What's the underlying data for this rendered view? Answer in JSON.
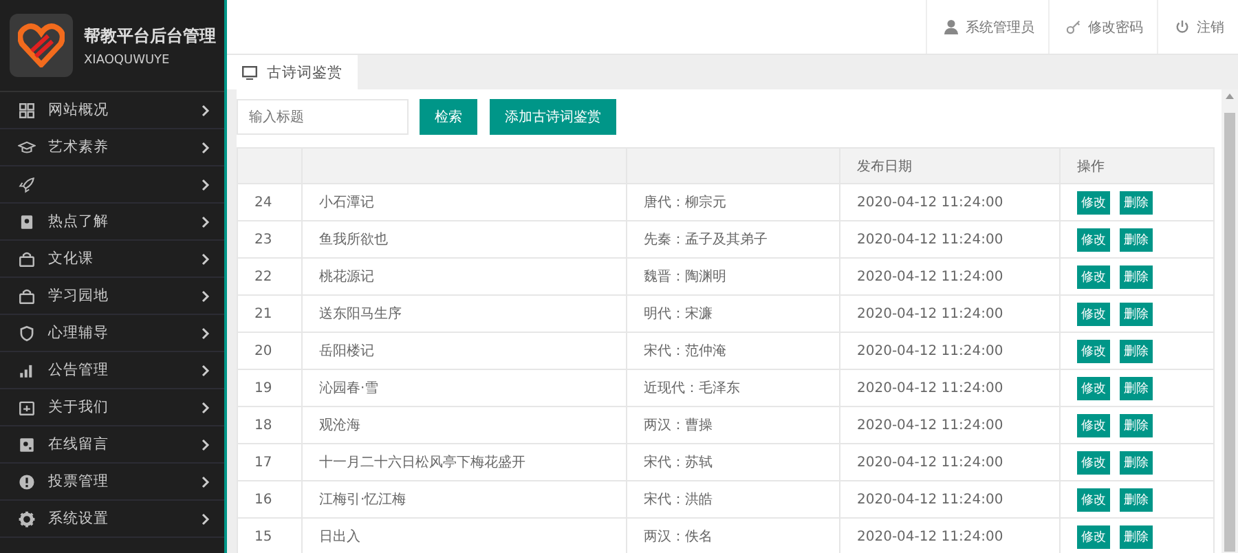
{
  "brand": {
    "title": "帮教平台后台管理",
    "subtitle": "XIAOQUWUYE"
  },
  "sidebar": {
    "items": [
      {
        "kind": "labeled",
        "label": "网站概况"
      },
      {
        "kind": "labeled",
        "label": "艺术素养"
      },
      {
        "kind": "icon_only"
      },
      {
        "kind": "labeled",
        "label": "热点了解"
      },
      {
        "kind": "labeled",
        "label": "文化课"
      },
      {
        "kind": "labeled",
        "label": "学习园地"
      },
      {
        "kind": "labeled",
        "label": "心理辅导"
      },
      {
        "kind": "labeled",
        "label": "公告管理"
      },
      {
        "kind": "labeled",
        "label": "关于我们"
      },
      {
        "kind": "labeled",
        "label": "在线留言"
      },
      {
        "kind": "labeled",
        "label": "投票管理"
      },
      {
        "kind": "labeled",
        "label": "系统设置"
      }
    ]
  },
  "header": {
    "user": "系统管理员",
    "change_password": "修改密码",
    "logout": "注销"
  },
  "tabs": [
    {
      "label": "古诗词鉴赏",
      "selected": true
    }
  ],
  "search": {
    "placeholder": "输入标题",
    "search_button": "检索",
    "add_button": "添加古诗词鉴赏"
  },
  "table": {
    "columns": [
      {
        "kind": "blank"
      },
      {
        "kind": "blank"
      },
      {
        "kind": "blank"
      },
      {
        "kind": "text",
        "label": "发布日期"
      },
      {
        "kind": "text",
        "label": "操作"
      }
    ],
    "rows": [
      {
        "id": "24",
        "title": "小石潭记",
        "author": "唐代：柳宗元",
        "date": "2020-04-12 11:24:00",
        "edit": "修改",
        "delete": "删除"
      },
      {
        "id": "23",
        "title": "鱼我所欲也",
        "author": "先秦：孟子及其弟子",
        "date": "2020-04-12 11:24:00",
        "edit": "修改",
        "delete": "删除"
      },
      {
        "id": "22",
        "title": "桃花源记",
        "author": "魏晋：陶渊明",
        "date": "2020-04-12 11:24:00",
        "edit": "修改",
        "delete": "删除"
      },
      {
        "id": "21",
        "title": "送东阳马生序",
        "author": "明代：宋濂",
        "date": "2020-04-12 11:24:00",
        "edit": "修改",
        "delete": "删除"
      },
      {
        "id": "20",
        "title": "岳阳楼记",
        "author": "宋代：范仲淹",
        "date": "2020-04-12 11:24:00",
        "edit": "修改",
        "delete": "删除"
      },
      {
        "id": "19",
        "title": "沁园春·雪",
        "author": "近现代：毛泽东",
        "date": "2020-04-12 11:24:00",
        "edit": "修改",
        "delete": "删除"
      },
      {
        "id": "18",
        "title": "观沧海",
        "author": "两汉：曹操",
        "date": "2020-04-12 11:24:00",
        "edit": "修改",
        "delete": "删除"
      },
      {
        "id": "17",
        "title": "十一月二十六日松风亭下梅花盛开",
        "author": "宋代：苏轼",
        "date": "2020-04-12 11:24:00",
        "edit": "修改",
        "delete": "删除"
      },
      {
        "id": "16",
        "title": "江梅引·忆江梅",
        "author": "宋代：洪皓",
        "date": "2020-04-12 11:24:00",
        "edit": "修改",
        "delete": "删除"
      },
      {
        "id": "15",
        "title": "日出入",
        "author": "两汉：佚名",
        "date": "2020-04-12 11:24:00",
        "edit": "修改",
        "delete": "删除"
      }
    ]
  }
}
